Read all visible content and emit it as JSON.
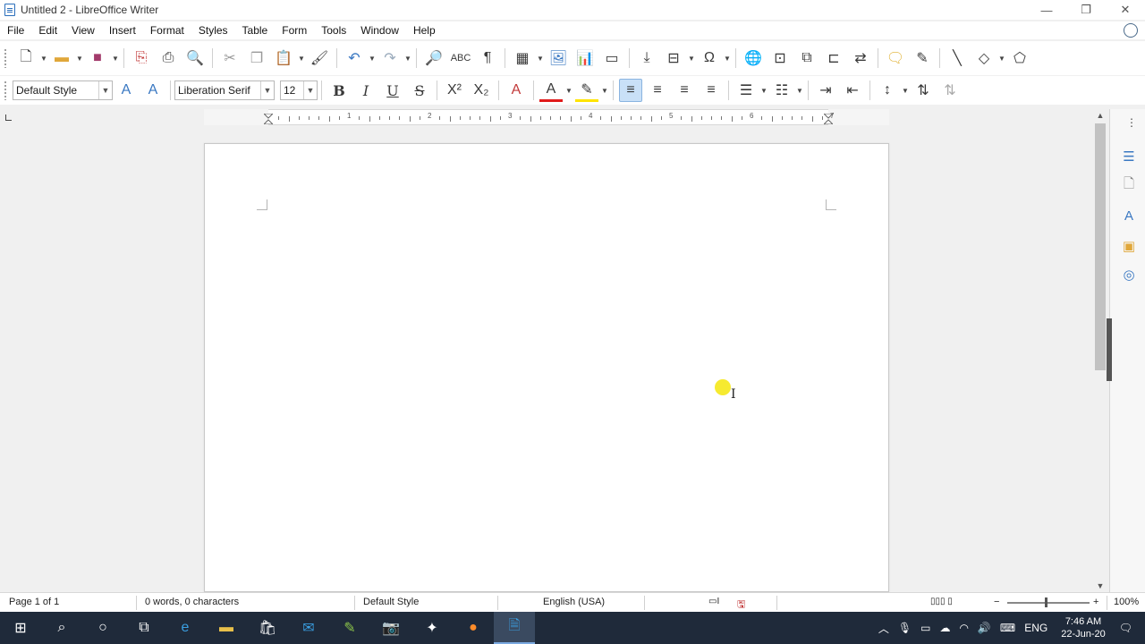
{
  "window": {
    "title": "Untitled 2 - LibreOffice Writer",
    "minimize": "—",
    "restore": "❐",
    "close": "✕"
  },
  "menu": [
    "File",
    "Edit",
    "View",
    "Insert",
    "Format",
    "Styles",
    "Table",
    "Form",
    "Tools",
    "Window",
    "Help"
  ],
  "formatting": {
    "paragraph_style": "Default Style",
    "font_name": "Liberation Serif",
    "font_size": "12",
    "bold": "B",
    "italic": "I",
    "underline": "U",
    "strike": "S",
    "superscript": "X²",
    "subscript": "X₂"
  },
  "ruler": {
    "numbers": [
      "1",
      "2",
      "3",
      "4",
      "5",
      "6",
      "7"
    ]
  },
  "status": {
    "page": "Page 1 of 1",
    "words": "0 words, 0 characters",
    "style": "Default Style",
    "language": "English (USA)",
    "zoom": "100%",
    "zoom_minus": "−",
    "zoom_plus": "+"
  },
  "taskbar": {
    "lang": "ENG",
    "time": "7:46 AM",
    "date": "22-Jun-20"
  },
  "colors": {
    "accent": "#3a78c2",
    "font_color_bar": "#e11b1b",
    "highlight_bar": "#ffe400",
    "taskbar_bg": "#1f2a3a"
  }
}
